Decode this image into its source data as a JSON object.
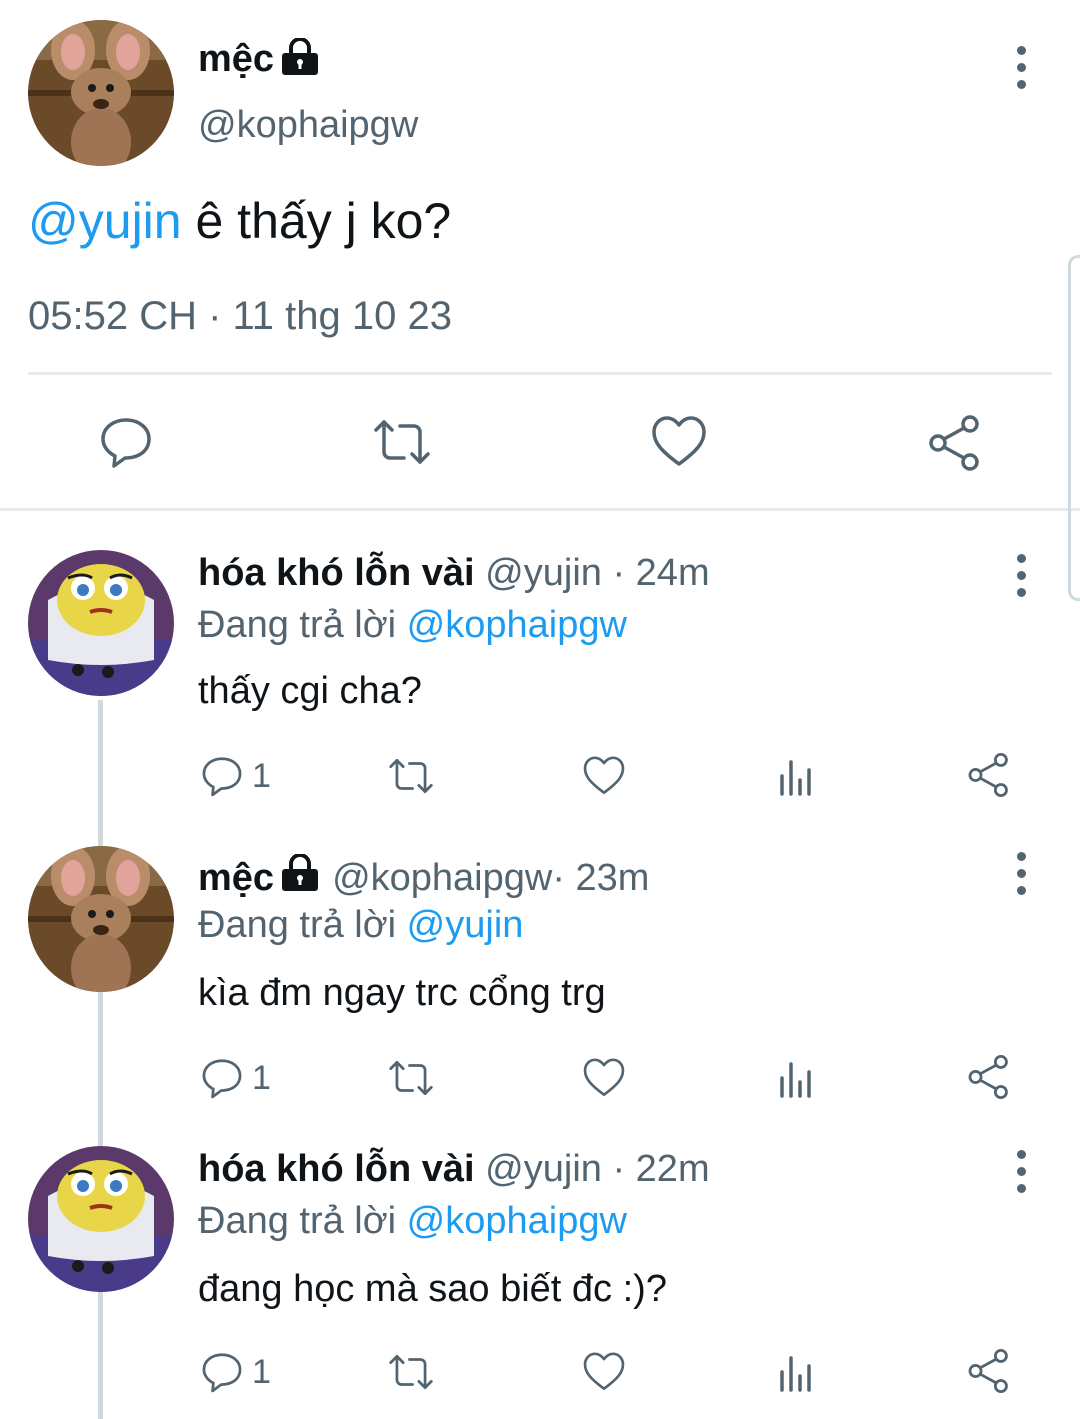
{
  "main_tweet": {
    "author_name": "mệc",
    "handle": "@kophaipgw",
    "mention": "@yujin",
    "text": " ê thấy j ko?",
    "timestamp": "05:52 CH · 11 thg 10 23",
    "actions": [
      "reply-icon",
      "retweet-icon",
      "like-icon",
      "share-icon"
    ]
  },
  "replies": [
    {
      "author_name": "hóa khó lỗn vài",
      "handle": "@yujin",
      "time": " · 24m",
      "replying_label": "Đang trả lời",
      "replying_to": "@kophaipgw",
      "text": "thấy cgi cha?",
      "reply_count": "1"
    },
    {
      "author_name": "mệc",
      "handle": "@kophaipgw",
      "time": " · 23m",
      "replying_label": "Đang trả lời",
      "replying_to": "@yujin",
      "text": "kìa đm ngay trc cổng trg",
      "reply_count": "1"
    },
    {
      "author_name": "hóa khó lỗn vài",
      "handle": "@yujin",
      "time": " · 22m",
      "replying_label": "Đang trả lời",
      "replying_to": "@kophaipgw",
      "text": "đang học mà sao biết đc :)?",
      "reply_count": "1"
    }
  ],
  "colors": {
    "text": "#0f1419",
    "muted": "#536471",
    "link": "#1d9bf0",
    "divider": "#e7e9ea"
  }
}
